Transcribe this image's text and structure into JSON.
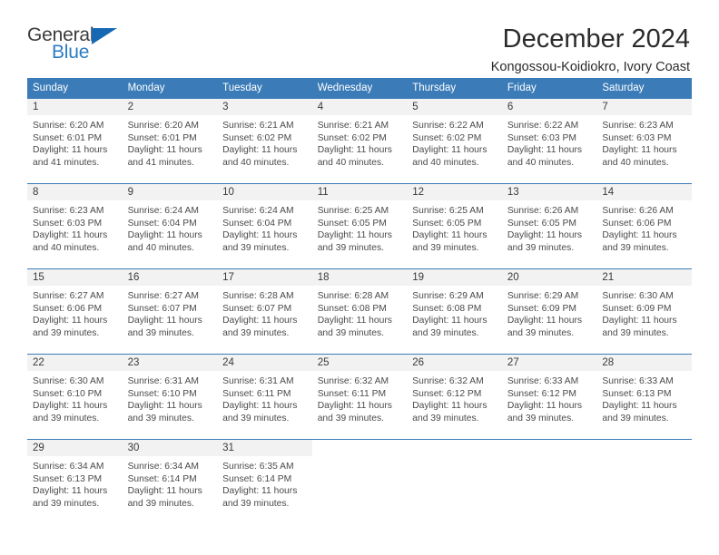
{
  "logo": {
    "word1": "General",
    "word2": "Blue",
    "triangle_color": "#1668b3",
    "blue_color": "#2b7cc4"
  },
  "header": {
    "title": "December 2024",
    "location": "Kongossou-Koidiokro, Ivory Coast"
  },
  "theme": {
    "header_bg": "#3b7cb8",
    "daynum_bg": "#f2f2f2",
    "text": "#4a4a4a"
  },
  "calendar": {
    "weekdays": [
      "Sunday",
      "Monday",
      "Tuesday",
      "Wednesday",
      "Thursday",
      "Friday",
      "Saturday"
    ],
    "weeks": [
      [
        {
          "day": "1",
          "sunrise": "Sunrise: 6:20 AM",
          "sunset": "Sunset: 6:01 PM",
          "daylight1": "Daylight: 11 hours",
          "daylight2": "and 41 minutes."
        },
        {
          "day": "2",
          "sunrise": "Sunrise: 6:20 AM",
          "sunset": "Sunset: 6:01 PM",
          "daylight1": "Daylight: 11 hours",
          "daylight2": "and 41 minutes."
        },
        {
          "day": "3",
          "sunrise": "Sunrise: 6:21 AM",
          "sunset": "Sunset: 6:02 PM",
          "daylight1": "Daylight: 11 hours",
          "daylight2": "and 40 minutes."
        },
        {
          "day": "4",
          "sunrise": "Sunrise: 6:21 AM",
          "sunset": "Sunset: 6:02 PM",
          "daylight1": "Daylight: 11 hours",
          "daylight2": "and 40 minutes."
        },
        {
          "day": "5",
          "sunrise": "Sunrise: 6:22 AM",
          "sunset": "Sunset: 6:02 PM",
          "daylight1": "Daylight: 11 hours",
          "daylight2": "and 40 minutes."
        },
        {
          "day": "6",
          "sunrise": "Sunrise: 6:22 AM",
          "sunset": "Sunset: 6:03 PM",
          "daylight1": "Daylight: 11 hours",
          "daylight2": "and 40 minutes."
        },
        {
          "day": "7",
          "sunrise": "Sunrise: 6:23 AM",
          "sunset": "Sunset: 6:03 PM",
          "daylight1": "Daylight: 11 hours",
          "daylight2": "and 40 minutes."
        }
      ],
      [
        {
          "day": "8",
          "sunrise": "Sunrise: 6:23 AM",
          "sunset": "Sunset: 6:03 PM",
          "daylight1": "Daylight: 11 hours",
          "daylight2": "and 40 minutes."
        },
        {
          "day": "9",
          "sunrise": "Sunrise: 6:24 AM",
          "sunset": "Sunset: 6:04 PM",
          "daylight1": "Daylight: 11 hours",
          "daylight2": "and 40 minutes."
        },
        {
          "day": "10",
          "sunrise": "Sunrise: 6:24 AM",
          "sunset": "Sunset: 6:04 PM",
          "daylight1": "Daylight: 11 hours",
          "daylight2": "and 39 minutes."
        },
        {
          "day": "11",
          "sunrise": "Sunrise: 6:25 AM",
          "sunset": "Sunset: 6:05 PM",
          "daylight1": "Daylight: 11 hours",
          "daylight2": "and 39 minutes."
        },
        {
          "day": "12",
          "sunrise": "Sunrise: 6:25 AM",
          "sunset": "Sunset: 6:05 PM",
          "daylight1": "Daylight: 11 hours",
          "daylight2": "and 39 minutes."
        },
        {
          "day": "13",
          "sunrise": "Sunrise: 6:26 AM",
          "sunset": "Sunset: 6:05 PM",
          "daylight1": "Daylight: 11 hours",
          "daylight2": "and 39 minutes."
        },
        {
          "day": "14",
          "sunrise": "Sunrise: 6:26 AM",
          "sunset": "Sunset: 6:06 PM",
          "daylight1": "Daylight: 11 hours",
          "daylight2": "and 39 minutes."
        }
      ],
      [
        {
          "day": "15",
          "sunrise": "Sunrise: 6:27 AM",
          "sunset": "Sunset: 6:06 PM",
          "daylight1": "Daylight: 11 hours",
          "daylight2": "and 39 minutes."
        },
        {
          "day": "16",
          "sunrise": "Sunrise: 6:27 AM",
          "sunset": "Sunset: 6:07 PM",
          "daylight1": "Daylight: 11 hours",
          "daylight2": "and 39 minutes."
        },
        {
          "day": "17",
          "sunrise": "Sunrise: 6:28 AM",
          "sunset": "Sunset: 6:07 PM",
          "daylight1": "Daylight: 11 hours",
          "daylight2": "and 39 minutes."
        },
        {
          "day": "18",
          "sunrise": "Sunrise: 6:28 AM",
          "sunset": "Sunset: 6:08 PM",
          "daylight1": "Daylight: 11 hours",
          "daylight2": "and 39 minutes."
        },
        {
          "day": "19",
          "sunrise": "Sunrise: 6:29 AM",
          "sunset": "Sunset: 6:08 PM",
          "daylight1": "Daylight: 11 hours",
          "daylight2": "and 39 minutes."
        },
        {
          "day": "20",
          "sunrise": "Sunrise: 6:29 AM",
          "sunset": "Sunset: 6:09 PM",
          "daylight1": "Daylight: 11 hours",
          "daylight2": "and 39 minutes."
        },
        {
          "day": "21",
          "sunrise": "Sunrise: 6:30 AM",
          "sunset": "Sunset: 6:09 PM",
          "daylight1": "Daylight: 11 hours",
          "daylight2": "and 39 minutes."
        }
      ],
      [
        {
          "day": "22",
          "sunrise": "Sunrise: 6:30 AM",
          "sunset": "Sunset: 6:10 PM",
          "daylight1": "Daylight: 11 hours",
          "daylight2": "and 39 minutes."
        },
        {
          "day": "23",
          "sunrise": "Sunrise: 6:31 AM",
          "sunset": "Sunset: 6:10 PM",
          "daylight1": "Daylight: 11 hours",
          "daylight2": "and 39 minutes."
        },
        {
          "day": "24",
          "sunrise": "Sunrise: 6:31 AM",
          "sunset": "Sunset: 6:11 PM",
          "daylight1": "Daylight: 11 hours",
          "daylight2": "and 39 minutes."
        },
        {
          "day": "25",
          "sunrise": "Sunrise: 6:32 AM",
          "sunset": "Sunset: 6:11 PM",
          "daylight1": "Daylight: 11 hours",
          "daylight2": "and 39 minutes."
        },
        {
          "day": "26",
          "sunrise": "Sunrise: 6:32 AM",
          "sunset": "Sunset: 6:12 PM",
          "daylight1": "Daylight: 11 hours",
          "daylight2": "and 39 minutes."
        },
        {
          "day": "27",
          "sunrise": "Sunrise: 6:33 AM",
          "sunset": "Sunset: 6:12 PM",
          "daylight1": "Daylight: 11 hours",
          "daylight2": "and 39 minutes."
        },
        {
          "day": "28",
          "sunrise": "Sunrise: 6:33 AM",
          "sunset": "Sunset: 6:13 PM",
          "daylight1": "Daylight: 11 hours",
          "daylight2": "and 39 minutes."
        }
      ],
      [
        {
          "day": "29",
          "sunrise": "Sunrise: 6:34 AM",
          "sunset": "Sunset: 6:13 PM",
          "daylight1": "Daylight: 11 hours",
          "daylight2": "and 39 minutes."
        },
        {
          "day": "30",
          "sunrise": "Sunrise: 6:34 AM",
          "sunset": "Sunset: 6:14 PM",
          "daylight1": "Daylight: 11 hours",
          "daylight2": "and 39 minutes."
        },
        {
          "day": "31",
          "sunrise": "Sunrise: 6:35 AM",
          "sunset": "Sunset: 6:14 PM",
          "daylight1": "Daylight: 11 hours",
          "daylight2": "and 39 minutes."
        },
        {
          "day": "",
          "sunrise": "",
          "sunset": "",
          "daylight1": "",
          "daylight2": ""
        },
        {
          "day": "",
          "sunrise": "",
          "sunset": "",
          "daylight1": "",
          "daylight2": ""
        },
        {
          "day": "",
          "sunrise": "",
          "sunset": "",
          "daylight1": "",
          "daylight2": ""
        },
        {
          "day": "",
          "sunrise": "",
          "sunset": "",
          "daylight1": "",
          "daylight2": ""
        }
      ]
    ]
  }
}
